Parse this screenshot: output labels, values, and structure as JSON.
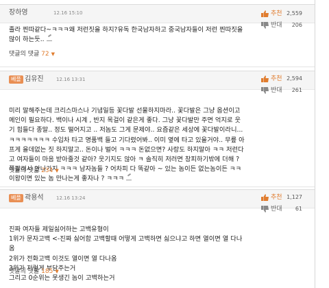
{
  "comments": [
    {
      "best": "",
      "author": "장하영",
      "time": "12.16 15:10",
      "up_label": "추천",
      "up_count": "2,559",
      "down_label": "반대",
      "down_count": "206",
      "lines": [
        "졸라 찐따같다~ㅋㅋㅋ왜 저런짓을 하지?유독 한국남자하고 중국남자들이 저런 찐따짓을",
        "많이 하는듯.."
      ],
      "replies_label": "댓글의 댓글",
      "replies_count": "72"
    },
    {
      "best": "베플",
      "author": "김유진",
      "time": "12.16 13:31",
      "up_label": "추천",
      "up_count": "2,594",
      "down_label": "반대",
      "down_count": "261",
      "lines": [
        "미리 말해주는데 크리스마스나 기념일등 꽃다발 선물하지마라.. 꽃다발은 그냥 옵션이고",
        "메인이 필요하다. 백이나 시계 , 반지 목걸이 같은게 좋다. 그냥 꽃다발만 주면 억지로 웃",
        "기 힘들다 종말.. 정도 떨어지고 .. 저놈도 그게 문제야.. 요즘같은 세상에 꽃다발이라니...",
        "ㅋㅋㅋㅋㅋㅋㅋ 수입차 타고 명품백 들고 기다렸어봐.. 이미 옆에 타고 있을거야.. 무릎 아",
        "프게 을데없는 짓 하지말고.. 돈이나 벌어 ㅋㅋㅋ 돈없으면? 사랑도 하지말아 ㅋㅋ 저런다",
        "고 여자들이 마음 받아줄것 같아? 웃기지도 않아 ㅋ 솔직히 저러면 창피하기밖에 더해 ?",
        "쪽팔려서 안나가지 ㅋㅋㅋ 남자놈들 ? 어차피 다 똑같아 ~ 있는 놈이든 없는놈이든 ㅋㅋ",
        "이왕이면 있는 놈 만나는게 좋자나 ? ㅋㅋㅋ"
      ],
      "replies_label": "댓글의 댓글",
      "replies_count": "234"
    },
    {
      "best": "베플",
      "author": "곽용석",
      "time": "12.16 13:24",
      "up_label": "추천",
      "up_count": "1,127",
      "down_label": "반대",
      "down_count": "61",
      "lines": [
        "진짜 여자들 제일싫어하는 고백유형이",
        "1위가 문자고백 <-진짜 싫어함 고백할때 어떻게 고백하면 싫으냐고 하면 열이면 열 다나",
        "옴",
        "2위가 전화고백 이것도 열이면 열 다나옴",
        "3위가 저렇게 부담주는거",
        "그리고 0순위는 못생긴 놈이 고백하는거"
      ],
      "replies_label": "댓글의 댓글",
      "replies_count": "185"
    }
  ]
}
